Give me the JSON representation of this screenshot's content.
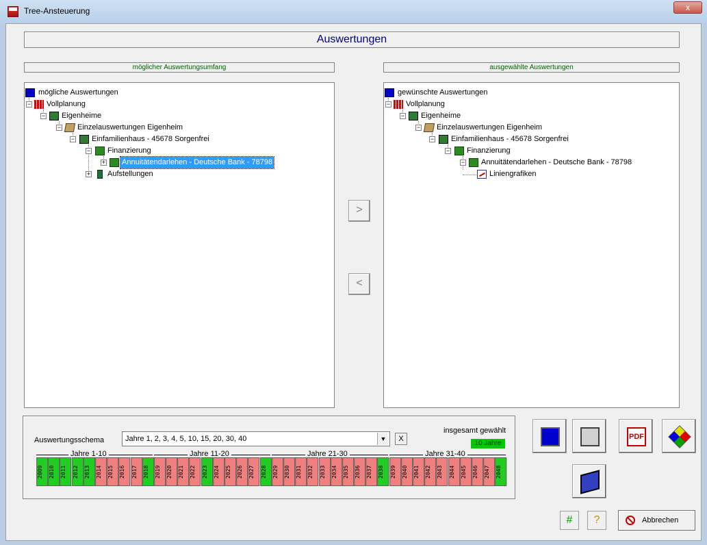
{
  "window": {
    "title": "Tree-Ansteuerung",
    "close_glyph": "x"
  },
  "header": {
    "title": "Auswertungen"
  },
  "left_panel": {
    "caption": "möglicher Auswertungsumfang",
    "nodes": [
      "mögliche Auswertungen",
      "Vollplanung",
      "Eigenheime",
      "Einzelauswertungen Eigenheim",
      "Einfamilienhaus - 45678 Sorgenfrei",
      "Finanzierung",
      "Annuitätendarlehen - Deutsche Bank - 78798",
      "Aufstellungen"
    ]
  },
  "right_panel": {
    "caption": "ausgewählte Auswertungen",
    "nodes": [
      "gewünschte Auswertungen",
      "Vollplanung",
      "Eigenheime",
      "Einzelauswertungen Eigenheim",
      "Einfamilienhaus - 45678 Sorgenfrei",
      "Finanzierung",
      "Annuitätendarlehen - Deutsche Bank - 78798",
      "Liniengrafiken"
    ]
  },
  "move_buttons": {
    "add": ">",
    "remove": "<"
  },
  "schema": {
    "label": "Auswertungsschema",
    "selected": "Jahre 1, 2, 3, 4, 5, 10, 15, 20, 30, 40",
    "clear_glyph": "X",
    "total_label": "insgesamt gewählt",
    "total_value": "10 Jahre"
  },
  "year_groups": [
    "Jahre 1-10",
    "Jahre 11-20",
    "Jahre 21-30",
    "Jahre 31-40"
  ],
  "years": [
    {
      "y": "2009",
      "on": true
    },
    {
      "y": "2010",
      "on": true
    },
    {
      "y": "2011",
      "on": true
    },
    {
      "y": "2012",
      "on": true
    },
    {
      "y": "2013",
      "on": true
    },
    {
      "y": "2014",
      "on": false
    },
    {
      "y": "2015",
      "on": false
    },
    {
      "y": "2016",
      "on": false
    },
    {
      "y": "2017",
      "on": false
    },
    {
      "y": "2018",
      "on": true
    },
    {
      "y": "2019",
      "on": false
    },
    {
      "y": "2020",
      "on": false
    },
    {
      "y": "2021",
      "on": false
    },
    {
      "y": "2022",
      "on": false
    },
    {
      "y": "2023",
      "on": true
    },
    {
      "y": "2024",
      "on": false
    },
    {
      "y": "2025",
      "on": false
    },
    {
      "y": "2026",
      "on": false
    },
    {
      "y": "2027",
      "on": false
    },
    {
      "y": "2028",
      "on": true
    },
    {
      "y": "2029",
      "on": false
    },
    {
      "y": "2030",
      "on": false
    },
    {
      "y": "2031",
      "on": false
    },
    {
      "y": "2032",
      "on": false
    },
    {
      "y": "2033",
      "on": false
    },
    {
      "y": "2034",
      "on": false
    },
    {
      "y": "2035",
      "on": false
    },
    {
      "y": "2036",
      "on": false
    },
    {
      "y": "2037",
      "on": false
    },
    {
      "y": "2038",
      "on": true
    },
    {
      "y": "2039",
      "on": false
    },
    {
      "y": "2040",
      "on": false
    },
    {
      "y": "2041",
      "on": false
    },
    {
      "y": "2042",
      "on": false
    },
    {
      "y": "2043",
      "on": false
    },
    {
      "y": "2044",
      "on": false
    },
    {
      "y": "2045",
      "on": false
    },
    {
      "y": "2046",
      "on": false
    },
    {
      "y": "2047",
      "on": false
    },
    {
      "y": "2048",
      "on": true
    }
  ],
  "colors": {
    "year_on": "#22cc22",
    "year_off": "#f08080",
    "selection": "#3399ff"
  },
  "actions": {
    "screen_icon": "monitor-icon",
    "print_icon": "printer-icon",
    "pdf_label": "PDF",
    "export_icon": "export-icon",
    "save_icon": "save-icon",
    "grid_glyph": "#",
    "help_glyph": "?",
    "cancel_label": "Abbrechen"
  }
}
